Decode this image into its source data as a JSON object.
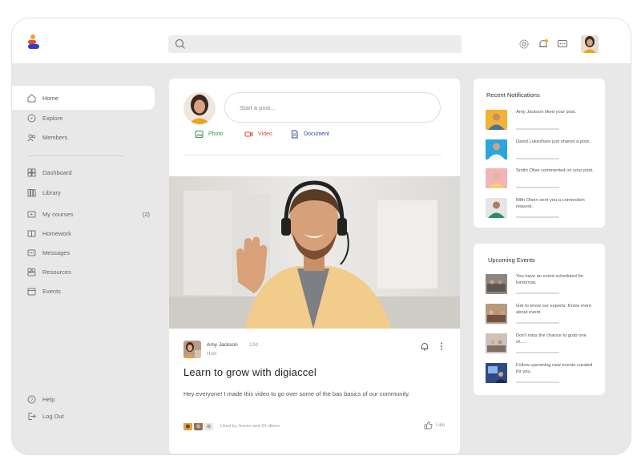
{
  "header": {
    "search_placeholder": "",
    "icons": [
      "settings-icon",
      "bell-icon",
      "chat-icon"
    ],
    "accent_colors": {
      "orange": "#f5a623",
      "blue": "#2b63d9",
      "navy": "#22336b",
      "red": "#e54b2e"
    }
  },
  "sidebar": {
    "items": [
      {
        "label": "Home",
        "icon": "home-icon",
        "active": true
      },
      {
        "label": "Explore",
        "icon": "compass-icon"
      },
      {
        "label": "Members",
        "icon": "members-icon"
      },
      {
        "label": "Dashboard",
        "icon": "dashboard-icon"
      },
      {
        "label": "Library",
        "icon": "library-icon"
      },
      {
        "label": "My courses",
        "icon": "courses-icon",
        "count": "(2)"
      },
      {
        "label": "Homework",
        "icon": "book-icon"
      },
      {
        "label": "Messages",
        "icon": "message-icon"
      },
      {
        "label": "Resources",
        "icon": "resources-icon"
      },
      {
        "label": "Events",
        "icon": "calendar-icon"
      }
    ],
    "footer": [
      {
        "label": "Help",
        "icon": "help-icon"
      },
      {
        "label": "Log Out",
        "icon": "logout-icon"
      }
    ]
  },
  "composer": {
    "placeholder": "Start a post...",
    "photo_label": "Photo",
    "video_label": "Video",
    "document_label": "Document"
  },
  "post": {
    "author": "Amy Jackson",
    "time": "12d",
    "role": "Host",
    "title": "Learn to grow with digiaccel",
    "body": "Hey everyone! I made this video to go over some of the bas basics of our community.",
    "liked_by": "Liked by Jeroen and 34 others",
    "like_label": "Like"
  },
  "notifications": {
    "title": "Recent Notifications",
    "items": [
      {
        "text": "Amy Jackson liked your post."
      },
      {
        "text": "David Lukeshare just shared a post."
      },
      {
        "text": "Smith Olive commented on your post."
      },
      {
        "text": "Mith Olsen sent you a connection request."
      }
    ]
  },
  "events": {
    "title": "Upcoming Events",
    "items": [
      {
        "text": "You have an event scheduled for tomorrow."
      },
      {
        "text": "Get to know our experts: Know more about event"
      },
      {
        "text": "Don't miss the chance to grab one of....."
      },
      {
        "text": "Follow upcoming new events curated for you."
      }
    ]
  }
}
